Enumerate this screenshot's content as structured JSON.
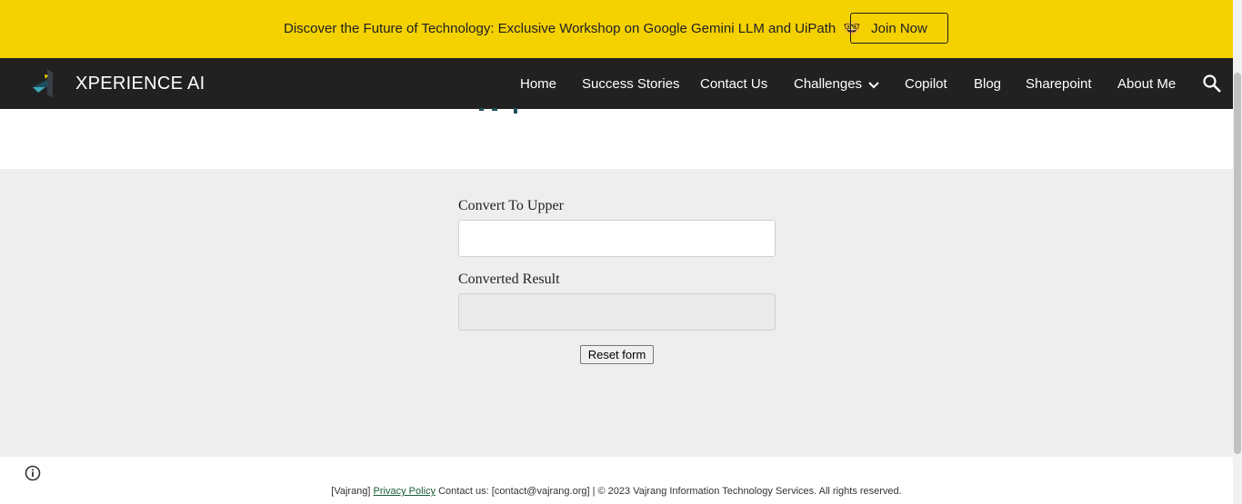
{
  "banner": {
    "text": "Discover the Future of Technology: Exclusive Workshop on Google Gemini LLM and UiPath",
    "emoji": "🤓",
    "cta_label": "Join Now",
    "background_color": "#f4d100"
  },
  "nav": {
    "site_title": "XPERIENCE AI",
    "logo_icon": "logo-icon",
    "background_color": "#212121",
    "items": [
      {
        "label": "Home"
      },
      {
        "label": "Success Stories"
      },
      {
        "label": "Contact Us"
      },
      {
        "label": "Challenges",
        "has_dropdown": true
      },
      {
        "label": "Copilot"
      },
      {
        "label": "Blog"
      },
      {
        "label": "Sharepoint"
      },
      {
        "label": "About Me"
      }
    ],
    "dropdown_icon": "chevron-down-icon",
    "search_icon": "search-icon"
  },
  "form": {
    "background_color": "#eeeeee",
    "upper_label": "Convert To Upper",
    "upper_value": "",
    "result_label": "Converted Result",
    "result_value": "",
    "reset_label": "Reset form"
  },
  "footer": {
    "info_icon": "info-icon",
    "prefix": "[Vajrang]",
    "privacy_link": "Privacy Policy",
    "contact_text": "Contact us: [contact@vajrang.org] | © 2023 Vajrang Information Technology Services. All rights reserved."
  }
}
